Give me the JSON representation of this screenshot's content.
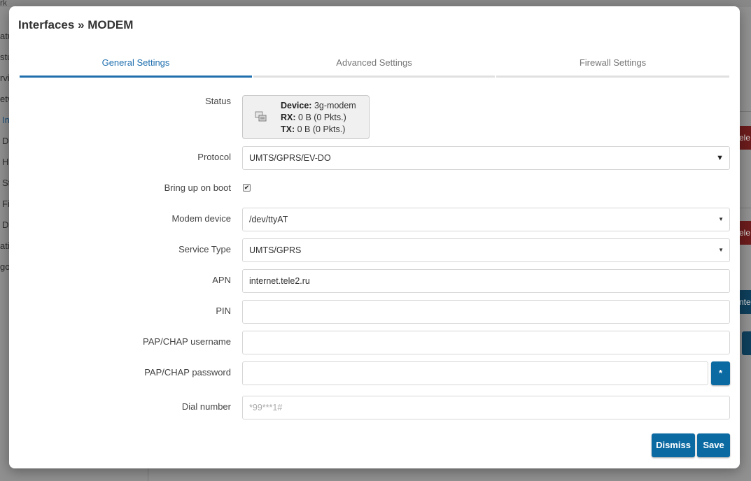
{
  "background": {
    "topbar_text": "rk",
    "sidebar_items": [
      "atu",
      "stu",
      "rvi",
      "etv",
      "In",
      "D",
      "H",
      "St",
      "Fi",
      "D",
      "ati",
      "go"
    ],
    "right_buttons": [
      "ele",
      "ele",
      "nte",
      ""
    ]
  },
  "modal": {
    "title": "Interfaces » MODEM",
    "tabs": [
      "General Settings",
      "Advanced Settings",
      "Firewall Settings"
    ],
    "active_tab": "General Settings",
    "status": {
      "label": "Status",
      "device_key": "Device:",
      "device_value": "3g-modem",
      "rx_key": "RX:",
      "rx_value": "0 B (0 Pkts.)",
      "tx_key": "TX:",
      "tx_value": "0 B (0 Pkts.)",
      "icon": "network-interface-icon"
    },
    "protocol": {
      "label": "Protocol",
      "value": "UMTS/GPRS/EV-DO"
    },
    "bring_up": {
      "label": "Bring up on boot",
      "checked": true
    },
    "modem_device": {
      "label": "Modem device",
      "value": "/dev/ttyAT"
    },
    "service_type": {
      "label": "Service Type",
      "value": "UMTS/GPRS"
    },
    "apn": {
      "label": "APN",
      "value": "internet.tele2.ru"
    },
    "pin": {
      "label": "PIN",
      "value": ""
    },
    "pap_user": {
      "label": "PAP/CHAP username",
      "value": ""
    },
    "pap_pass": {
      "label": "PAP/CHAP password",
      "value": "",
      "reveal_label": "*"
    },
    "dial": {
      "label": "Dial number",
      "value": "",
      "placeholder": "*99***1#"
    },
    "buttons": {
      "dismiss": "Dismiss",
      "save": "Save"
    }
  },
  "colors": {
    "accent": "#0c6aa3",
    "tab_active": "#1f6fae"
  }
}
